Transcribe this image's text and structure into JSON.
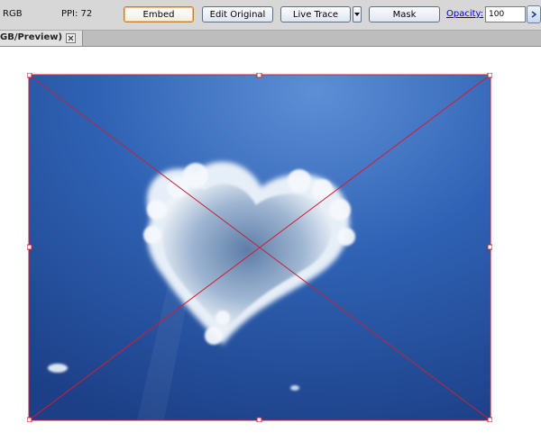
{
  "control_bar": {
    "color_mode": "RGB",
    "ppi": "PPI: 72",
    "embed_label": "Embed",
    "edit_original_label": "Edit Original",
    "live_trace_label": "Live Trace",
    "mask_label": "Mask",
    "opacity_label": "Opacity:",
    "opacity_value": "100"
  },
  "document_tab": {
    "title": "GB/Preview)"
  },
  "colors": {
    "selection": "#cc1f33",
    "sky_dark": "#1c3f86",
    "sky_light": "#5d8fd6",
    "control_bar_bg": "#d7d7d7"
  },
  "icons": {
    "live_trace_dropdown": "dropdown-arrow-icon",
    "tab_close": "close-icon",
    "opacity_more": "chevron-right-icon"
  }
}
